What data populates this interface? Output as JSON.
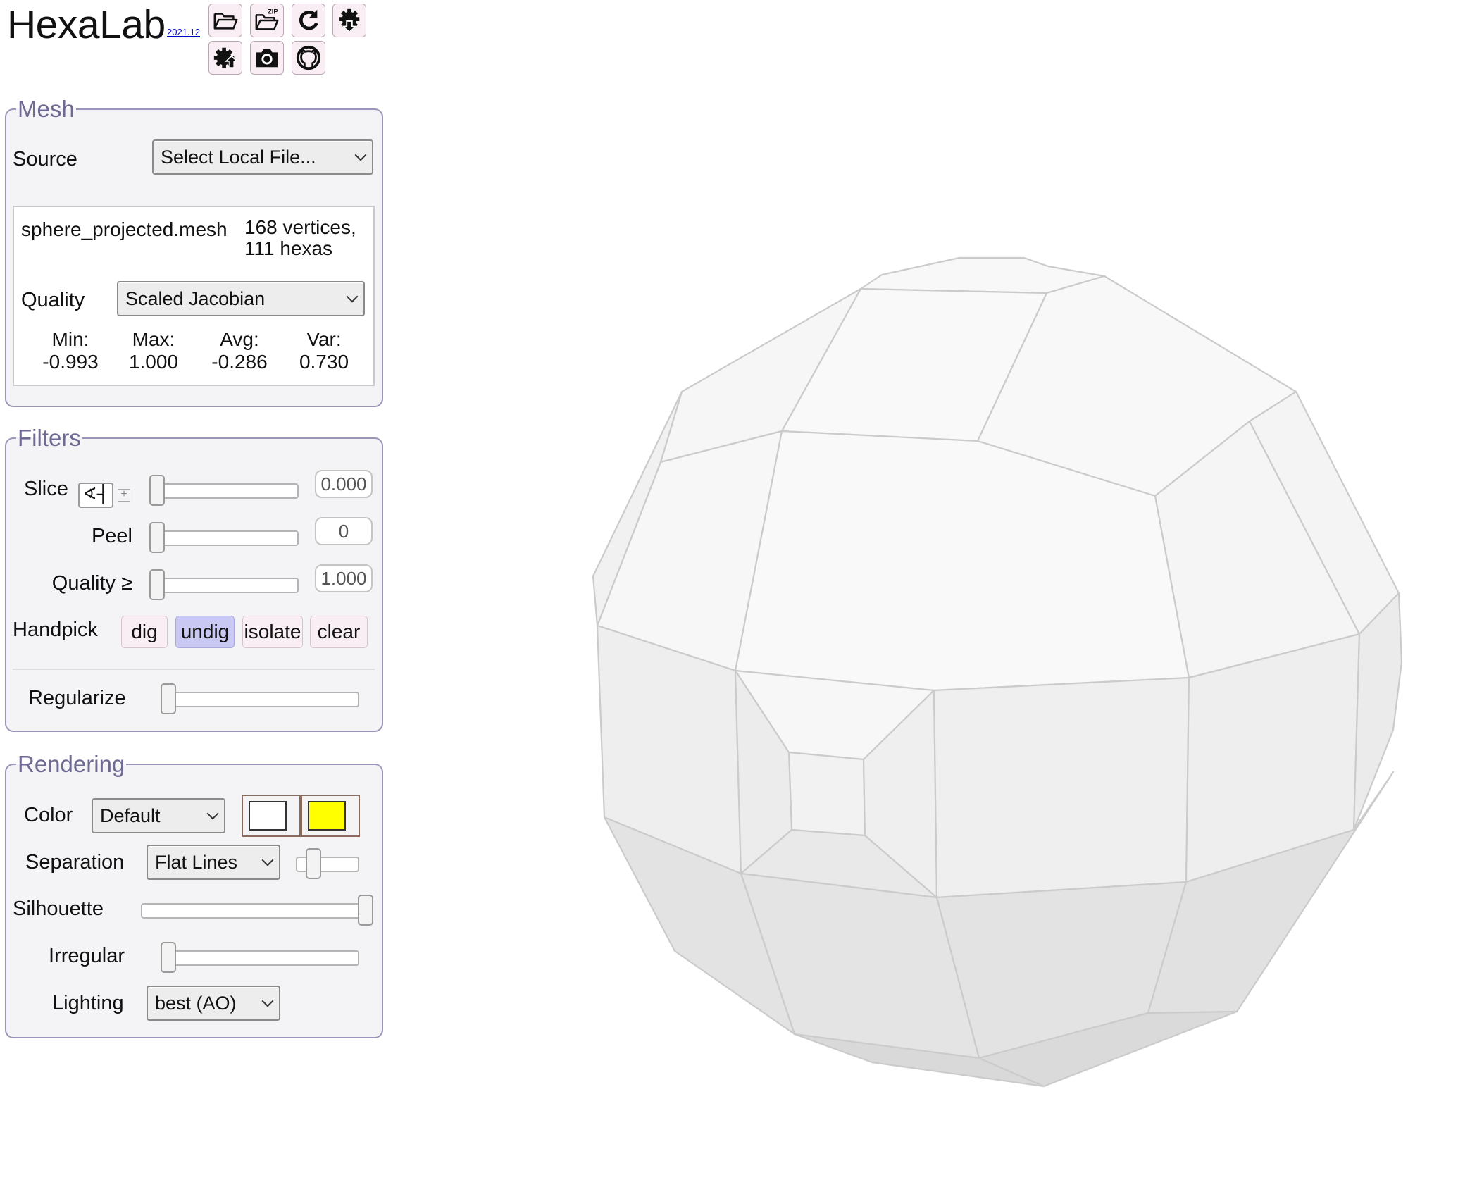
{
  "header": {
    "title": "HexaLab",
    "version": "2021.12",
    "toolbar": [
      {
        "name": "open-folder-icon"
      },
      {
        "name": "open-zip-icon",
        "badge": "ZIP"
      },
      {
        "name": "reload-icon"
      },
      {
        "name": "settings-download-icon"
      },
      {
        "name": "settings-upload-icon"
      },
      {
        "name": "camera-icon"
      },
      {
        "name": "github-icon"
      }
    ]
  },
  "mesh": {
    "legend": "Mesh",
    "source_label": "Source",
    "source_value": "Select Local File...",
    "filename": "sphere_projected.mesh",
    "vertices": "168 vertices,",
    "hexas": "111 hexas",
    "quality_label": "Quality",
    "quality_value": "Scaled Jacobian",
    "stats": [
      {
        "label": "Min:",
        "value": "-0.993"
      },
      {
        "label": "Max:",
        "value": "1.000"
      },
      {
        "label": "Avg:",
        "value": "-0.286"
      },
      {
        "label": "Var:",
        "value": "0.730"
      }
    ]
  },
  "filters": {
    "legend": "Filters",
    "slice_label": "Slice",
    "slice_value": "0.000",
    "slice_level": 0,
    "peel_label": "Peel",
    "peel_value": "0",
    "peel_level": 0,
    "quality_label": "Quality ≥",
    "quality_value": "1.000",
    "quality_level": 0,
    "handpick_label": "Handpick",
    "handpick_buttons": [
      "dig",
      "undig",
      "isolate",
      "clear"
    ],
    "handpick_active": "undig",
    "regularize_label": "Regularize",
    "regularize_level": 0
  },
  "rendering": {
    "legend": "Rendering",
    "color_label": "Color",
    "color_value": "Default",
    "color_swatches": [
      "#ffffff",
      "#ffff00"
    ],
    "separation_label": "Separation",
    "separation_value": "Flat Lines",
    "separation_level": 0.2,
    "silhouette_label": "Silhouette",
    "silhouette_level": 1,
    "irregular_label": "Irregular",
    "irregular_level": 0,
    "lighting_label": "Lighting",
    "lighting_value": "best (AO)"
  },
  "colors": {
    "panel_border": "#9a94b8",
    "legend": "#6e6a94",
    "button_bg": "#f9eef3",
    "active_button_bg": "#c9c8f2",
    "mesh_face": "#f4f4f4",
    "mesh_edge": "#c9c9c9"
  }
}
